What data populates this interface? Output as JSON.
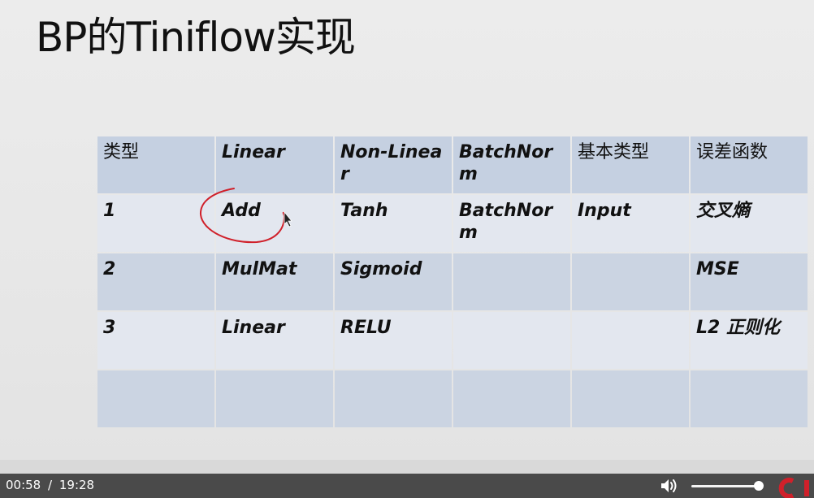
{
  "slide": {
    "title": "BP的Tiniflow实现"
  },
  "table": {
    "rows": [
      [
        "类型",
        "Linear",
        "Non-Linear",
        "BatchNorm",
        "基本类型",
        "误差函数"
      ],
      [
        "1",
        "Add",
        "Tanh",
        "BatchNorm",
        "Input",
        "交叉熵"
      ],
      [
        "2",
        "MulMat",
        "Sigmoid",
        "",
        "",
        "MSE"
      ],
      [
        "3",
        "Linear",
        "RELU",
        "",
        "",
        "L2 正则化"
      ],
      [
        "",
        "",
        "",
        "",
        "",
        ""
      ]
    ],
    "colors": {
      "header": "#c5d0e1",
      "odd": "#e3e7ef",
      "even": "#cbd4e2"
    }
  },
  "annotation": {
    "color": "#d0202a",
    "icon": "pen-circle-annotation"
  },
  "player": {
    "current_time": "00:58",
    "separator": "/",
    "duration": "19:28",
    "volume": 0.94,
    "icons": {
      "volume": "speaker-icon",
      "logo": "brand-logo-icon"
    },
    "accent": "#d0202a"
  }
}
